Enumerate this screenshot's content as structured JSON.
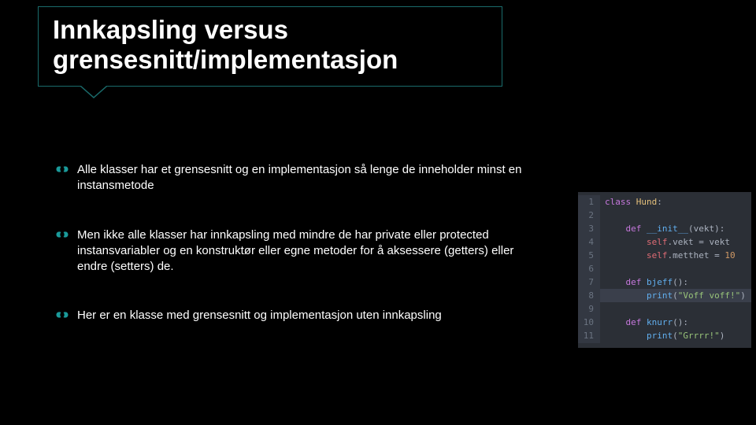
{
  "title": "Innkapsling versus grensesnitt/implementasjon",
  "bullets": [
    "Alle klasser har et grensesnitt og en implementasjon så lenge de inneholder minst en instansmetode",
    "Men ikke alle klasser har innkapsling med mindre de har private eller protected instansvariabler og en konstruktør eller egne metoder for å aksessere (getters) eller endre (setters) de.",
    "Her er en klasse med grensesnitt og implementasjon uten innkapsling"
  ],
  "code": {
    "class_name": "Hund",
    "lines": [
      {
        "n": "1",
        "tokens": [
          [
            "kw",
            "class "
          ],
          [
            "cls",
            "Hund"
          ],
          [
            "pln",
            ":"
          ]
        ]
      },
      {
        "n": "2",
        "tokens": []
      },
      {
        "n": "3",
        "tokens": [
          [
            "pln",
            "    "
          ],
          [
            "kw",
            "def "
          ],
          [
            "fn",
            "__init__"
          ],
          [
            "pln",
            "(vekt):"
          ]
        ]
      },
      {
        "n": "4",
        "tokens": [
          [
            "pln",
            "        "
          ],
          [
            "self",
            "self"
          ],
          [
            "pln",
            ".vekt = vekt"
          ]
        ]
      },
      {
        "n": "5",
        "tokens": [
          [
            "pln",
            "        "
          ],
          [
            "self",
            "self"
          ],
          [
            "pln",
            ".metthet = "
          ],
          [
            "num",
            "10"
          ]
        ]
      },
      {
        "n": "6",
        "tokens": []
      },
      {
        "n": "7",
        "tokens": [
          [
            "pln",
            "    "
          ],
          [
            "kw",
            "def "
          ],
          [
            "fn",
            "bjeff"
          ],
          [
            "pln",
            "():"
          ]
        ]
      },
      {
        "n": "8",
        "tokens": [
          [
            "pln",
            "        "
          ],
          [
            "fn",
            "print"
          ],
          [
            "pln",
            "("
          ],
          [
            "str",
            "\"Voff voff!\""
          ],
          [
            "pln",
            ")"
          ]
        ],
        "highlight": true
      },
      {
        "n": "9",
        "tokens": []
      },
      {
        "n": "10",
        "tokens": [
          [
            "pln",
            "    "
          ],
          [
            "kw",
            "def "
          ],
          [
            "fn",
            "knurr"
          ],
          [
            "pln",
            "():"
          ]
        ]
      },
      {
        "n": "11",
        "tokens": [
          [
            "pln",
            "        "
          ],
          [
            "fn",
            "print"
          ],
          [
            "pln",
            "("
          ],
          [
            "str",
            "\"Grrrr!\""
          ],
          [
            "pln",
            ")"
          ]
        ]
      }
    ]
  }
}
